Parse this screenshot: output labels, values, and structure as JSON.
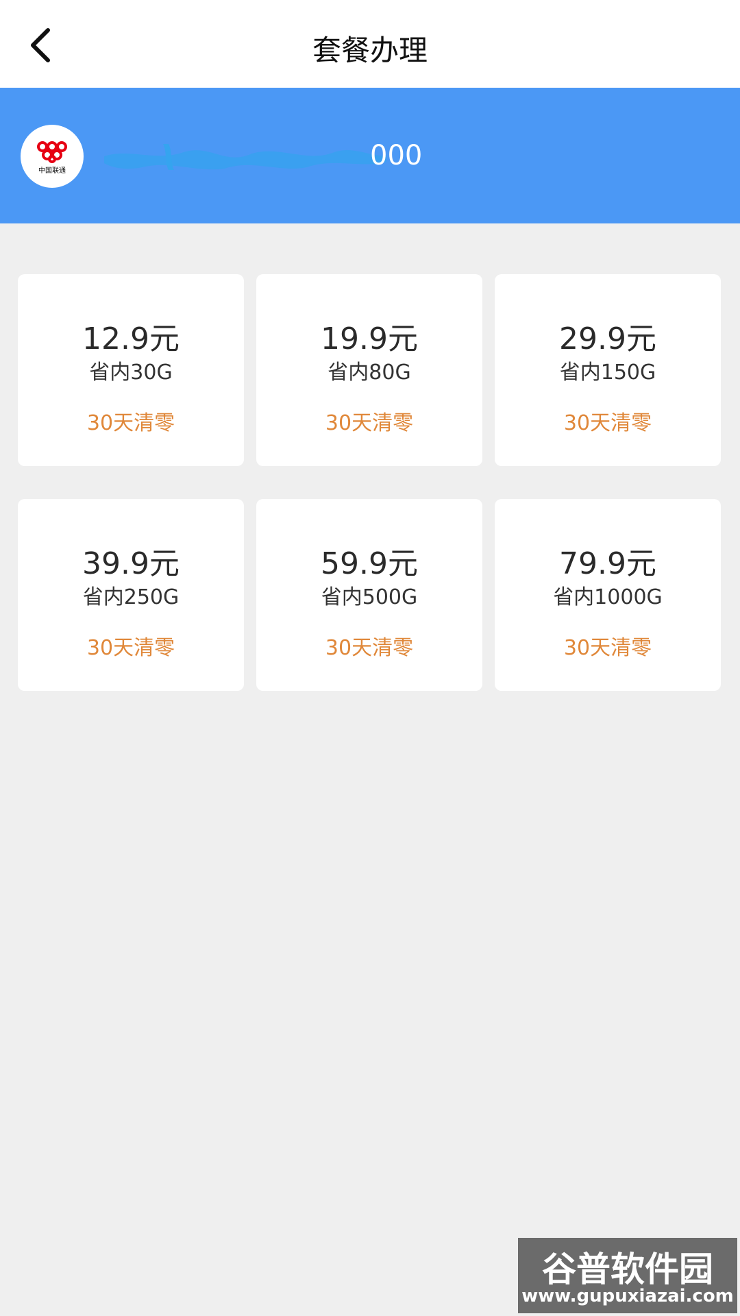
{
  "header": {
    "title": "套餐办理",
    "back_icon": "chevron-left-icon"
  },
  "account": {
    "carrier_logo": "china-unicom-logo",
    "carrier_name": "中国联通",
    "phone_visible_suffix": "000",
    "bar_color": "#4b98f5"
  },
  "packages": [
    {
      "price": "12.9元",
      "data": "省内30G",
      "validity": "30天清零"
    },
    {
      "price": "19.9元",
      "data": "省内80G",
      "validity": "30天清零"
    },
    {
      "price": "29.9元",
      "data": "省内150G",
      "validity": "30天清零"
    },
    {
      "price": "39.9元",
      "data": "省内250G",
      "validity": "30天清零"
    },
    {
      "price": "59.9元",
      "data": "省内500G",
      "validity": "30天清零"
    },
    {
      "price": "79.9元",
      "data": "省内1000G",
      "validity": "30天清零"
    }
  ],
  "colors": {
    "validity_text": "#e0883a",
    "background": "#efefef"
  },
  "watermark": {
    "title": "谷普软件园",
    "url": "www.gupuxiazai.com"
  }
}
